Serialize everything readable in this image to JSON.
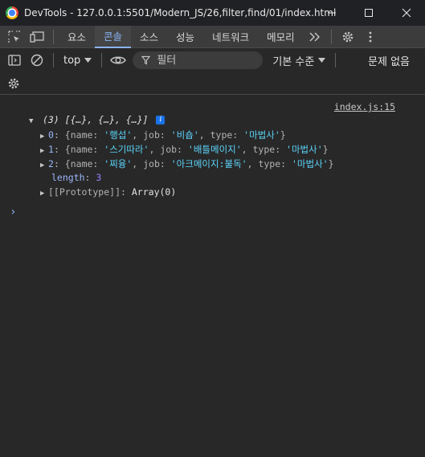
{
  "window": {
    "title": "DevTools - 127.0.0.1:5501/Modern_JS/26,filter,find/01/index.html"
  },
  "tabs": [
    {
      "label": "요소"
    },
    {
      "label": "콘솔"
    },
    {
      "label": "소스"
    },
    {
      "label": "성능"
    },
    {
      "label": "네트워크"
    },
    {
      "label": "메모리"
    }
  ],
  "active_tab": "콘솔",
  "toolbar": {
    "context": "top",
    "filter_placeholder": "필터",
    "levels": "기본 수준",
    "issues": "문제 없음"
  },
  "console": {
    "source": "index.js:15",
    "summary": "(3) [{…}, {…}, {…}]",
    "items": [
      {
        "index": "0",
        "name": "'행섭'",
        "job": "'비숍'",
        "type": "'마법사'"
      },
      {
        "index": "1",
        "name": "'스기따라'",
        "job": "'배틀메이지'",
        "type": "'마법사'"
      },
      {
        "index": "2",
        "name": "'찌융'",
        "job": "'아크메이지:불독'",
        "type": "'마법사'"
      }
    ],
    "length_key": "length",
    "length_value": "3",
    "prototype_key": "[[Prototype]]",
    "prototype_value": "Array(0)"
  },
  "colors": {
    "accent": "#8ab4f8",
    "string": "#5cd5fb",
    "number": "#9980ff",
    "background": "#282828"
  }
}
